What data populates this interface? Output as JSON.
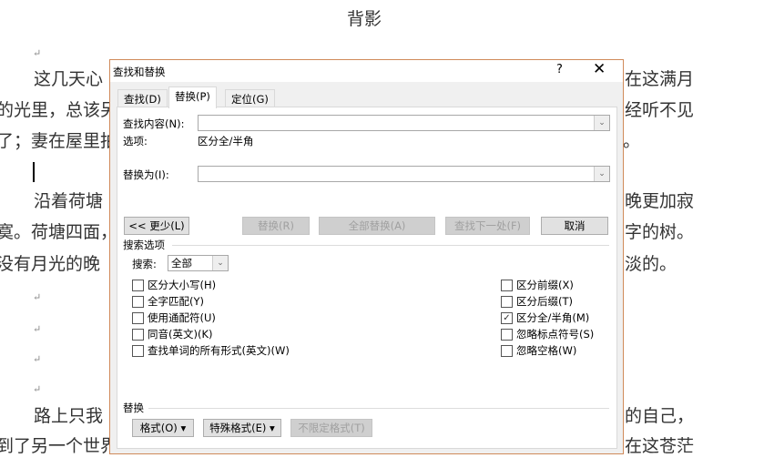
{
  "document": {
    "title": "背影",
    "lines": [
      {
        "left": "这几天心",
        "right": "在这满月"
      },
      {
        "left": "的光里，总该另",
        "right": "经听不见"
      },
      {
        "left": "了；妻在屋里拍",
        "right": "。"
      },
      {
        "left": "沿着荷塘",
        "right": "晚更加寂"
      },
      {
        "left": "寞。荷塘四面，",
        "right": "字的树。"
      },
      {
        "left": "没有月光的晚",
        "right": "淡的。"
      },
      {
        "left": "路上只我",
        "right": "的自己，"
      },
      {
        "left": "到了另一个世界",
        "right": "在这苍茫"
      }
    ]
  },
  "dialog": {
    "title": "查找和替换",
    "help": "?",
    "close": "✕",
    "tabs": [
      "查找(D)",
      "替换(P)",
      "定位(G)"
    ],
    "active_tab": "替换(P)",
    "find_label": "查找内容(N):",
    "find_value": "",
    "options_label": "选项:",
    "options_value": "区分全/半角",
    "replace_label": "替换为(I):",
    "replace_value": "",
    "buttons": {
      "less": "<< 更少(L)",
      "replace": "替换(R)",
      "replace_all": "全部替换(A)",
      "find_next": "查找下一处(F)",
      "cancel": "取消"
    },
    "search_options_heading": "搜索选项",
    "search_label": "搜索:",
    "search_value": "全部",
    "left_checks": [
      {
        "label": "区分大小写(H)",
        "checked": false
      },
      {
        "label": "全字匹配(Y)",
        "checked": false
      },
      {
        "label": "使用通配符(U)",
        "checked": false
      },
      {
        "label": "同音(英文)(K)",
        "checked": false
      },
      {
        "label": "查找单词的所有形式(英文)(W)",
        "checked": false
      }
    ],
    "right_checks": [
      {
        "label": "区分前缀(X)",
        "checked": false
      },
      {
        "label": "区分后缀(T)",
        "checked": false
      },
      {
        "label": "区分全/半角(M)",
        "checked": true
      },
      {
        "label": "忽略标点符号(S)",
        "checked": false
      },
      {
        "label": "忽略空格(W)",
        "checked": false
      }
    ],
    "replace_heading": "替换",
    "format_buttons": {
      "format": "格式(O) ▾",
      "special": "特殊格式(E) ▾",
      "no_format": "不限定格式(T)"
    }
  }
}
